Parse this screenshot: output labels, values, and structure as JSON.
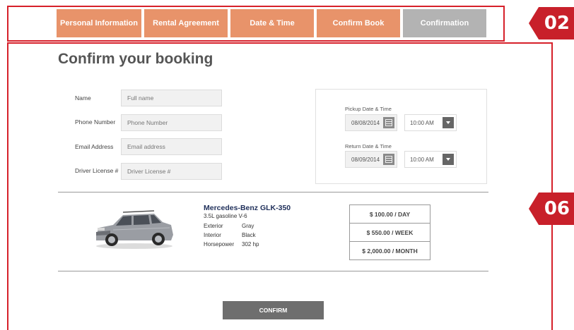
{
  "steps": [
    {
      "label": "Personal Information",
      "state": "done"
    },
    {
      "label": "Rental Agreement",
      "state": "done"
    },
    {
      "label": "Date & Time",
      "state": "done"
    },
    {
      "label": "Confirm Book",
      "state": "active"
    },
    {
      "label": "Confirmation",
      "state": "inactive"
    }
  ],
  "annotations": {
    "badge_top": "02",
    "badge_middle": "06"
  },
  "page_title": "Confirm your booking",
  "form": {
    "name_label": "Name",
    "name_placeholder": "Full name",
    "phone_label": "Phone Number",
    "phone_placeholder": "Phone Number",
    "email_label": "Email Address",
    "email_placeholder": "Email address",
    "license_label": "Driver License #",
    "license_placeholder": "Driver License #"
  },
  "pickup": {
    "label": "Pickup Date & Time",
    "date": "08/08/2014",
    "time": "10:00 AM"
  },
  "return": {
    "label": "Return Date & Time",
    "date": "08/09/2014",
    "time": "10:00 AM"
  },
  "car": {
    "name": "Mercedes-Benz GLK-350",
    "engine": "3.5L gasoline V-6",
    "specs": [
      {
        "key": "Exterior",
        "value": "Gray"
      },
      {
        "key": "Interior",
        "value": "Black"
      },
      {
        "key": "Horsepower",
        "value": "302 hp"
      }
    ]
  },
  "prices": [
    "$ 100.00 / DAY",
    "$ 550.00 / WEEK",
    "$ 2,000.00 / MONTH"
  ],
  "confirm_label": "CONFIRM",
  "colors": {
    "accent": "#e8936a",
    "inactive_tab": "#b3b3b3",
    "annotation": "#c8202a",
    "button": "#6e6e6e"
  }
}
